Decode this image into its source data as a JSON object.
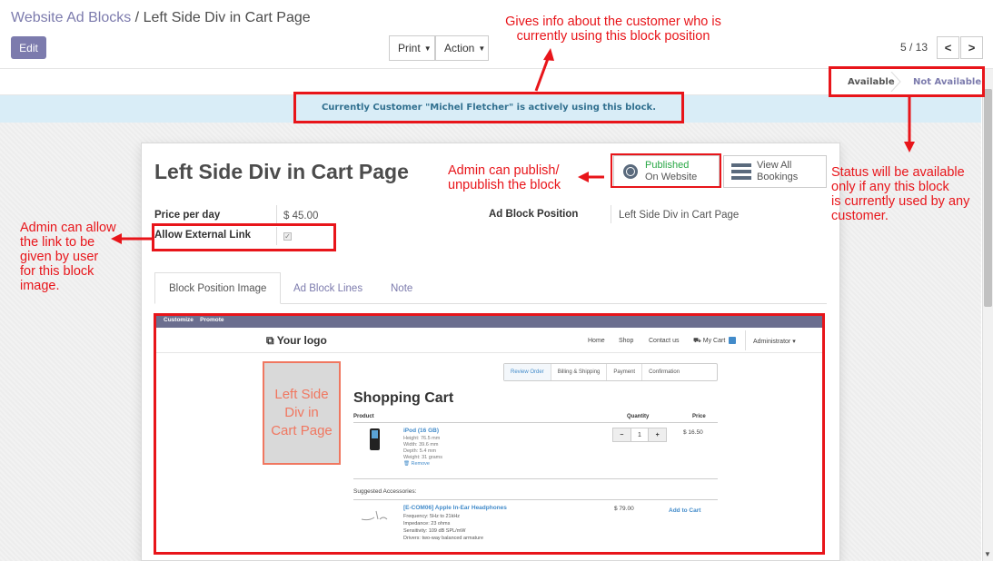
{
  "breadcrumb": {
    "parent": "Website Ad Blocks",
    "separator": "/",
    "current": "Left Side Div in Cart Page"
  },
  "toolbar": {
    "edit_label": "Edit",
    "print_label": "Print",
    "action_label": "Action"
  },
  "pager": {
    "value": "5 / 13",
    "prev_icon": "chevron-left",
    "next_icon": "chevron-right"
  },
  "statusbar": {
    "stages": [
      "Available",
      "Not Available"
    ],
    "active": "Not Available"
  },
  "alert": {
    "text": "Currently Customer \"Michel Fletcher\" is actively using this block."
  },
  "form": {
    "title": "Left Side Div in Cart Page",
    "published": {
      "line1": "Published",
      "line2": "On Website"
    },
    "bookings": {
      "line1": "View All",
      "line2": "Bookings"
    },
    "fields": {
      "price_label": "Price per day",
      "price_value": "$ 45.00",
      "external_label": "Allow External Link",
      "external_checked": true,
      "position_label": "Ad Block Position",
      "position_value": "Left Side Div in Cart Page"
    },
    "tabs": [
      "Block Position Image",
      "Ad Block Lines",
      "Note"
    ],
    "active_tab": "Block Position Image"
  },
  "preview": {
    "topbar": {
      "customize": "Customize",
      "promote": "Promote"
    },
    "logo": "Your logo",
    "nav": {
      "home": "Home",
      "shop": "Shop",
      "contact": "Contact us",
      "cart": "My Cart",
      "cart_count": "1",
      "user": "Administrator"
    },
    "steps": [
      "Review Order",
      "Billing & Shipping",
      "Payment",
      "Confirmation"
    ],
    "left_box": [
      "Left Side",
      "Div in",
      "Cart Page"
    ],
    "cart_title": "Shopping Cart",
    "headers": {
      "product": "Product",
      "quantity": "Quantity",
      "price": "Price"
    },
    "item": {
      "name": "iPod (16 GB)",
      "specs": [
        "Height: 76.5 mm",
        "Width: 39.6 mm",
        "Depth: 5.4 mm",
        "Weight: 31 grams"
      ],
      "remove": "Remove",
      "qty": "1",
      "price": "$ 16.50"
    },
    "suggested_label": "Suggested Accessories:",
    "accessory": {
      "name": "[E-COM06] Apple In-Ear Headphones",
      "specs": [
        "Frequency: 5Hz to 21kHz",
        "Impedance: 23 ohms",
        "Sensitivity: 109 dB SPL/mW",
        "Drivers: two-way balanced armature"
      ],
      "price": "$ 79.00",
      "add": "Add to Cart"
    }
  },
  "annotations": {
    "customer_info": [
      "Gives info about the customer who is",
      "currently using this block position"
    ],
    "publish": [
      "Admin can publish/",
      "unpublish the block"
    ],
    "status": [
      "Status will be available",
      "only if any this block",
      "is currently used by any",
      "customer."
    ],
    "external_link": [
      "Admin can allow",
      "the link to be",
      "given by user",
      "for this block",
      "image."
    ]
  },
  "colors": {
    "annotation": "#e8151a",
    "brand": "#7c7bad",
    "alert_bg": "#d9edf7",
    "alert_text": "#31708f"
  }
}
